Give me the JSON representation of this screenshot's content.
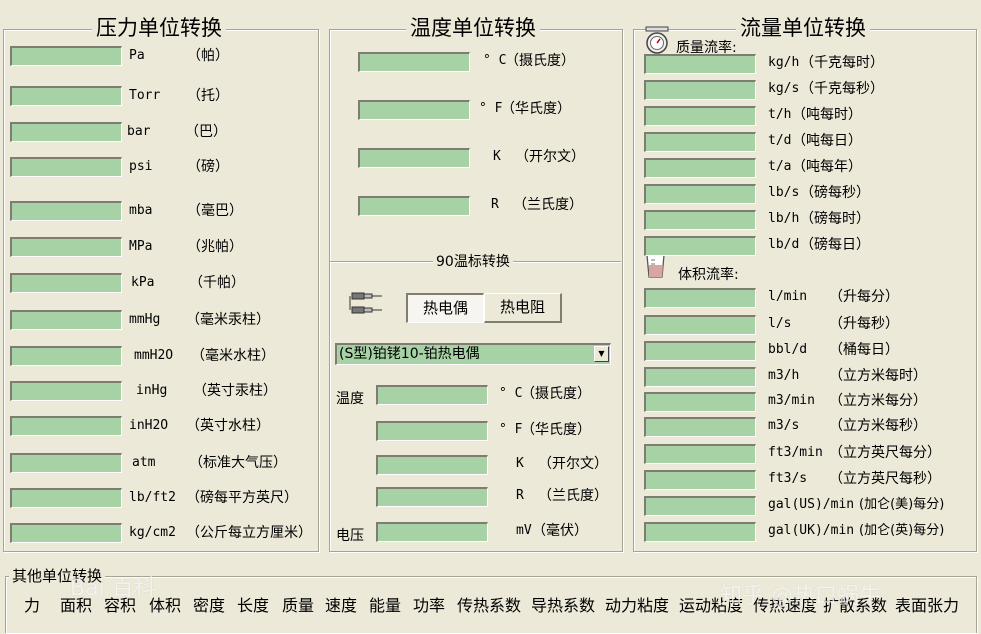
{
  "pressure": {
    "title": "压力单位转换",
    "rows": [
      {
        "unit": "Pa",
        "name": "（帕）"
      },
      {
        "unit": "Torr",
        "name": "（托）"
      },
      {
        "unit": "bar",
        "name": "（巴）"
      },
      {
        "unit": "psi",
        "name": "（磅）"
      },
      {
        "unit": "mba",
        "name": "（毫巴）"
      },
      {
        "unit": "MPa",
        "name": "（兆帕）"
      },
      {
        "unit": "kPa",
        "name": "（千帕）"
      },
      {
        "unit": "mmHg",
        "name": "（毫米汞柱）"
      },
      {
        "unit": "mmH2O",
        "name": "（毫米水柱）"
      },
      {
        "unit": "inHg",
        "name": "（英寸汞柱）"
      },
      {
        "unit": "inH2O",
        "name": "（英寸水柱）"
      },
      {
        "unit": "atm",
        "name": "（标准大气压）"
      },
      {
        "unit": "lb/ft2",
        "name": "（磅每平方英尺）"
      },
      {
        "unit": "kg/cm2",
        "name": "（公斤每立方厘米）"
      }
    ]
  },
  "temperature": {
    "title": "温度单位转换",
    "rows": [
      {
        "unit": "° C",
        "name": "（摄氏度）"
      },
      {
        "unit": "° F",
        "name": "（华氏度）"
      },
      {
        "unit": "K",
        "name": "（开尔文）"
      },
      {
        "unit": "R",
        "name": "（兰氏度）"
      }
    ]
  },
  "its90": {
    "title": "90温标转换",
    "tab_thermocouple": "热电偶",
    "tab_rtd": "热电阻",
    "sensor_selected": "(S型)铂铑10-铂热电偶",
    "temp_label": "温度",
    "voltage_label": "电压",
    "rows": [
      {
        "unit": "° C",
        "name": "（摄氏度）"
      },
      {
        "unit": "° F",
        "name": "（华氏度）"
      },
      {
        "unit": "K",
        "name": "（开尔文）"
      },
      {
        "unit": "R",
        "name": "（兰氏度）"
      }
    ],
    "voltage_unit": {
      "unit": "mV",
      "name": "（毫伏）"
    }
  },
  "flow": {
    "title": "流量单位转换",
    "mass_label": "质量流率:",
    "volume_label": "体积流率:",
    "mass_rows": [
      {
        "unit": "kg/h",
        "name": "（千克每时）"
      },
      {
        "unit": "kg/s",
        "name": "（千克每秒）"
      },
      {
        "unit": "t/h",
        "name": "（吨每时）"
      },
      {
        "unit": "t/d",
        "name": "（吨每日）"
      },
      {
        "unit": "t/a",
        "name": "（吨每年）"
      },
      {
        "unit": "lb/s",
        "name": "（磅每秒）"
      },
      {
        "unit": "lb/h",
        "name": "（磅每时）"
      },
      {
        "unit": "lb/d",
        "name": "（磅每日）"
      }
    ],
    "volume_rows": [
      {
        "unit": "l/min",
        "name": "（升每分）"
      },
      {
        "unit": "l/s",
        "name": "（升每秒）"
      },
      {
        "unit": "bbl/d",
        "name": "（桶每日）"
      },
      {
        "unit": "m3/h",
        "name": "（立方米每时）"
      },
      {
        "unit": "m3/min",
        "name": "（立方米每分）"
      },
      {
        "unit": "m3/s",
        "name": "（立方米每秒）"
      },
      {
        "unit": "ft3/min",
        "name": "（立方英尺每分）"
      },
      {
        "unit": "ft3/s",
        "name": "（立方英尺每秒）"
      },
      {
        "unit": "gal(US)/min",
        "name": "(加仑(美)每分)"
      },
      {
        "unit": "gal(UK)/min",
        "name": "(加仑(英)每分)"
      }
    ]
  },
  "other": {
    "title": "其他单位转换",
    "items": [
      "力",
      "面积",
      "容积",
      "体积",
      "密度",
      "长度",
      "质量",
      "速度",
      "能量",
      "功率",
      "传热系数",
      "导热系数",
      "动力粘度",
      "运动粘度",
      "传热速度",
      "扩散系数",
      "表面张力"
    ]
  },
  "watermarks": [
    "Bai 百科",
    "知乎 @热口蜗牛"
  ],
  "colors": {
    "field": "#a7d2a5",
    "background": "#ece9d8"
  }
}
